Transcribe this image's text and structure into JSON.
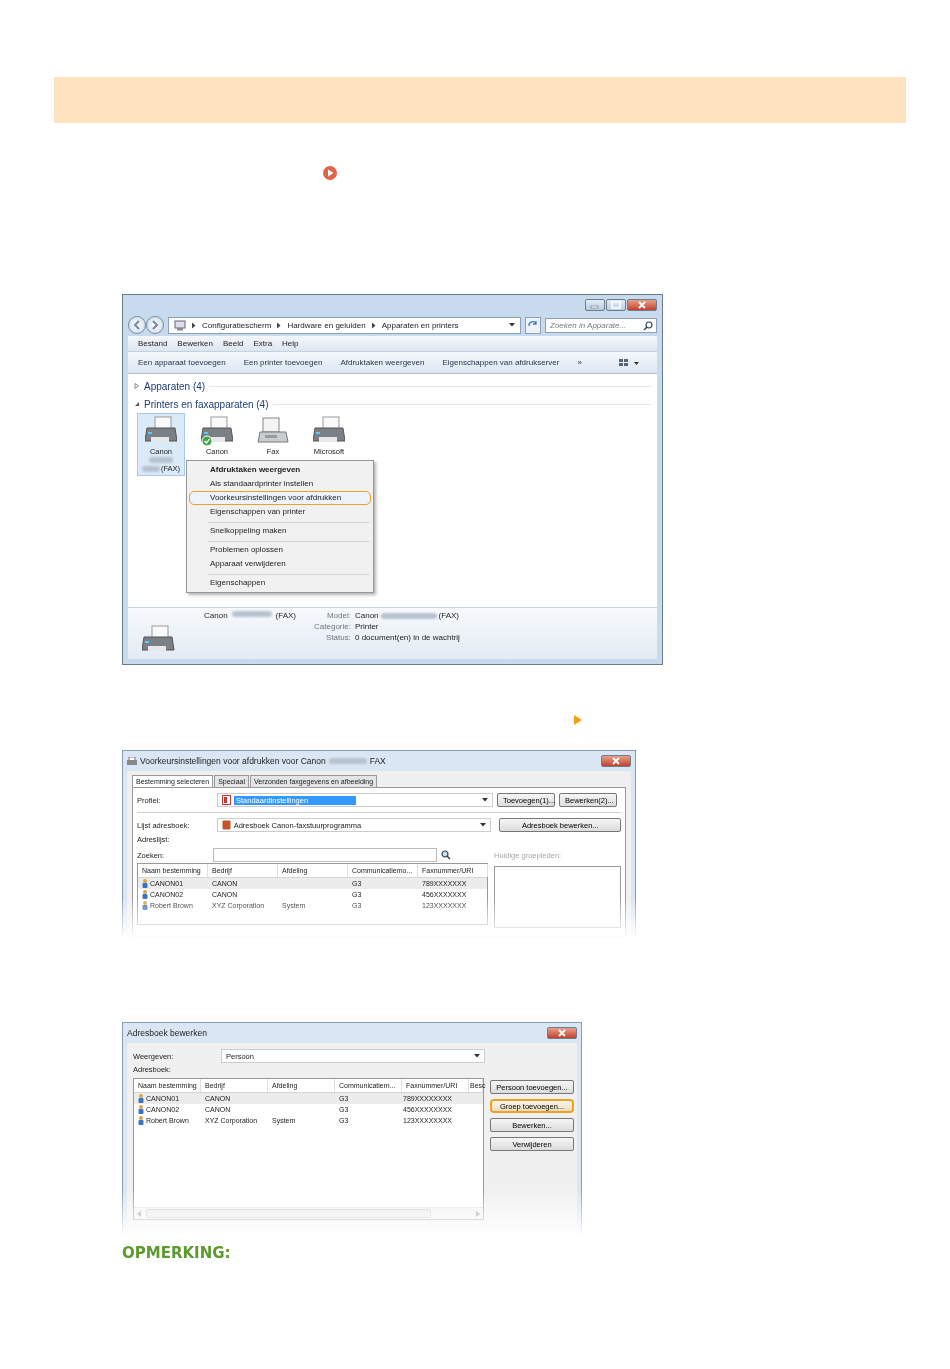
{
  "window1": {
    "breadcrumb": [
      "Configuratiescherm",
      "Hardware en geluiden",
      "Apparaten en printers"
    ],
    "search": {
      "placeholder": "Zoeken in Apparate..."
    },
    "menu": [
      "Bestand",
      "Bewerken",
      "Beeld",
      "Extra",
      "Help"
    ],
    "toolbar": [
      "Een apparaat toevoegen",
      "Een printer toevoegen",
      "Afdruktaken weergeven",
      "Eigenschappen van afdrukserver",
      "»"
    ],
    "groups": [
      {
        "label": "Apparaten (4)",
        "expanded": false
      },
      {
        "label": "Printers en faxapparaten (4)",
        "expanded": true
      }
    ],
    "devices": [
      {
        "label": "Canon",
        "suffix": "(FAX)",
        "redacted": true,
        "selected": true,
        "default": false,
        "kind": "printer"
      },
      {
        "label": "Canon",
        "redacted": false,
        "selected": false,
        "default": true,
        "kind": "printer"
      },
      {
        "label": "Fax",
        "redacted": false,
        "selected": false,
        "default": false,
        "kind": "fax"
      },
      {
        "label": "Microsoft",
        "redacted": false,
        "selected": false,
        "default": false,
        "kind": "printer"
      }
    ],
    "context_menu": [
      {
        "label": "Afdruktaken weergeven",
        "bold": true,
        "highlighted": false,
        "separator_before": false
      },
      {
        "label": "Als standaardprinter instellen",
        "bold": false,
        "highlighted": false,
        "separator_before": false
      },
      {
        "label": "Voorkeursinstellingen voor afdrukken",
        "bold": false,
        "highlighted": true,
        "separator_before": false
      },
      {
        "label": "Eigenschappen van printer",
        "bold": false,
        "highlighted": false,
        "separator_before": false
      },
      {
        "label": "Snelkoppeling maken",
        "bold": false,
        "highlighted": false,
        "separator_before": true
      },
      {
        "label": "Problemen oplossen",
        "bold": false,
        "highlighted": false,
        "separator_before": true
      },
      {
        "label": "Apparaat verwijderen",
        "bold": false,
        "highlighted": false,
        "separator_before": false
      },
      {
        "label": "Eigenschappen",
        "bold": false,
        "highlighted": false,
        "separator_before": true
      }
    ],
    "details": {
      "name": "Canon",
      "name_suffix": "(FAX)",
      "fields": [
        {
          "label": "Model:",
          "value": "Canon",
          "suffix": "(FAX)",
          "redacted": true
        },
        {
          "label": "Categorie:",
          "value": "Printer"
        },
        {
          "label": "Status:",
          "value": "0 document(en) in de wachtrij"
        }
      ]
    }
  },
  "window2": {
    "title": "Voorkeursinstellingen voor afdrukken voor Canon",
    "title_suffix": "FAX",
    "tabs": [
      {
        "label": "Bestemming selecteren",
        "selected": true
      },
      {
        "label": "Speciaal",
        "selected": false
      },
      {
        "label": "Verzonden faxgegevens en afbeelding",
        "selected": false
      }
    ],
    "profile": {
      "label": "Profiel:",
      "value": "Standaardinstellingen",
      "buttons": [
        "Toevoegen(1)...",
        "Bewerken(2)..."
      ]
    },
    "address_book": {
      "label": "Lijst adresboek:",
      "value": "Adresboek Canon-faxstuurprogramma",
      "button": "Adresboek bewerken..."
    },
    "address_list_label": "Adreslijst:",
    "search_label": "Zoeken:",
    "members_label": "Huidige groepleden:",
    "columns": [
      "Naam bestemming",
      "Bedrijf",
      "Afdeling",
      "Communicatiemo...",
      "Faxnummer/URI"
    ],
    "rows": [
      {
        "cells": [
          "CANON01",
          "CANON",
          "",
          "G3",
          "789XXXXXXX"
        ],
        "selected": true
      },
      {
        "cells": [
          "CANON02",
          "CANON",
          "",
          "G3",
          "456XXXXXXX"
        ],
        "selected": false
      },
      {
        "cells": [
          "Robert Brown",
          "XYZ Corporation",
          "System",
          "G3",
          "123XXXXXXX"
        ],
        "selected": false
      }
    ]
  },
  "window3": {
    "title": "Adresboek bewerken",
    "view_label": "Weergeven:",
    "view_value": "Persoon",
    "book_label": "Adresboek:",
    "columns": [
      "Naam bestemming",
      "Bedrijf",
      "Afdeling",
      "Communicatiem...",
      "Faxnummer/URI",
      "Besc"
    ],
    "rows": [
      {
        "cells": [
          "CANON01",
          "CANON",
          "",
          "G3",
          "789XXXXXXXX"
        ],
        "selected": true
      },
      {
        "cells": [
          "CANON02",
          "CANON",
          "",
          "G3",
          "456XXXXXXXX"
        ],
        "selected": false
      },
      {
        "cells": [
          "Robert Brown",
          "XYZ Corporation",
          "System",
          "G3",
          "123XXXXXXXX"
        ],
        "selected": false
      }
    ],
    "buttons": [
      {
        "label": "Persoon toevoegen...",
        "highlighted": false
      },
      {
        "label": "Groep toevoegen...",
        "highlighted": true
      },
      {
        "label": "Bewerken...",
        "highlighted": false
      },
      {
        "label": "Verwijderen",
        "highlighted": false
      }
    ]
  },
  "note_heading": "OPMERKING:"
}
